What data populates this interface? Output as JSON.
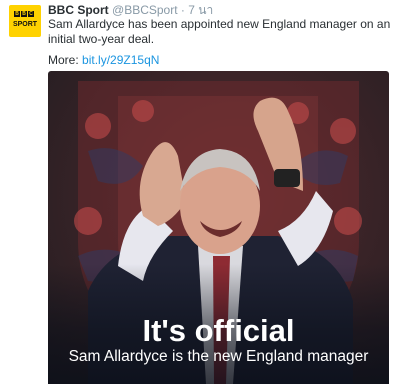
{
  "tweet": {
    "avatar": {
      "logo_letters": [
        "B",
        "B",
        "C"
      ],
      "logo_word": "SPORT"
    },
    "author_name": "BBC Sport",
    "author_handle": "@BBCSport",
    "separator": "·",
    "timestamp": "7 นา",
    "text": "Sam Allardyce has been appointed new England manager on an initial two-year deal.",
    "more_label": "More:",
    "more_link": "bit.ly/29Z15qN"
  },
  "media": {
    "headline": "It's official",
    "subline": "Sam Allardyce is the new England manager"
  },
  "colors": {
    "avatar_bg": "#ffd200",
    "link": "#1b95e0",
    "name_text": "#292f33",
    "meta_text": "#8899a6"
  }
}
